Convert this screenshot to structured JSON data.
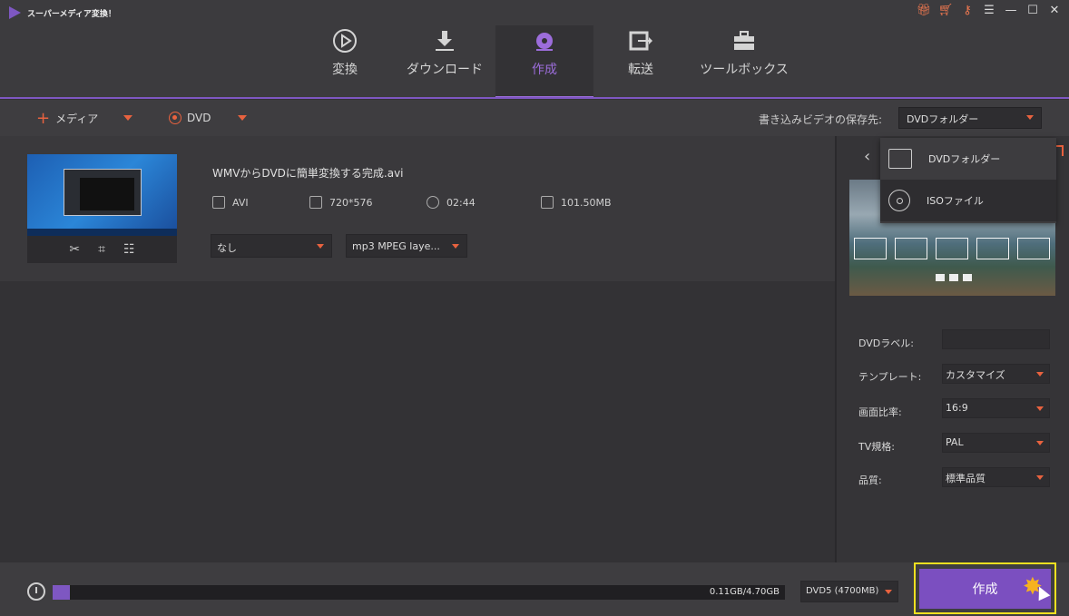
{
  "app": {
    "title": "スーパーメディア変換！"
  },
  "window_controls": {
    "icons": [
      "gift-icon",
      "cart-icon",
      "key-icon",
      "menu-icon",
      "minimize-icon",
      "maximize-icon",
      "close-icon"
    ]
  },
  "nav": {
    "items": [
      {
        "label": "変換",
        "icon": "play-circle-icon"
      },
      {
        "label": "ダウンロード",
        "icon": "download-icon"
      },
      {
        "label": "作成",
        "icon": "disc-icon",
        "active": true
      },
      {
        "label": "転送",
        "icon": "transfer-icon"
      },
      {
        "label": "ツールボックス",
        "icon": "toolbox-icon"
      }
    ]
  },
  "toolbar": {
    "add_media_label": "メディア",
    "dvd_label": "DVD",
    "save_to_label": "書き込みビデオの保存先:",
    "save_to_value": "DVDフォルダー"
  },
  "file": {
    "name": "WMVからDVDに簡単変換する完成.avi",
    "format": "AVI",
    "resolution": "720*576",
    "duration": "02:44",
    "size": "101.50MB",
    "subtitle_value": "なし",
    "audio_value": "mp3 MPEG laye..."
  },
  "save_popup": {
    "options": [
      "DVDフォルダー",
      "ISOファイル"
    ]
  },
  "settings": {
    "dvd_label_label": "DVDラベル:",
    "dvd_label_value": "",
    "template_label": "テンプレート:",
    "template_value": "カスタマイズ",
    "aspect_label": "画面比率:",
    "aspect_value": "16:9",
    "tv_label": "TV規格:",
    "tv_value": "PAL",
    "quality_label": "品質:",
    "quality_value": "標準品質"
  },
  "bottom": {
    "capacity_text": "0.11GB/4.70GB",
    "capacity_used_fraction": 0.0234,
    "disc_type": "DVD5 (4700MB)",
    "create_label": "作成"
  },
  "colors": {
    "accent": "#7e57c2",
    "highlight": "#f0e020",
    "arrow": "#e8623f"
  }
}
